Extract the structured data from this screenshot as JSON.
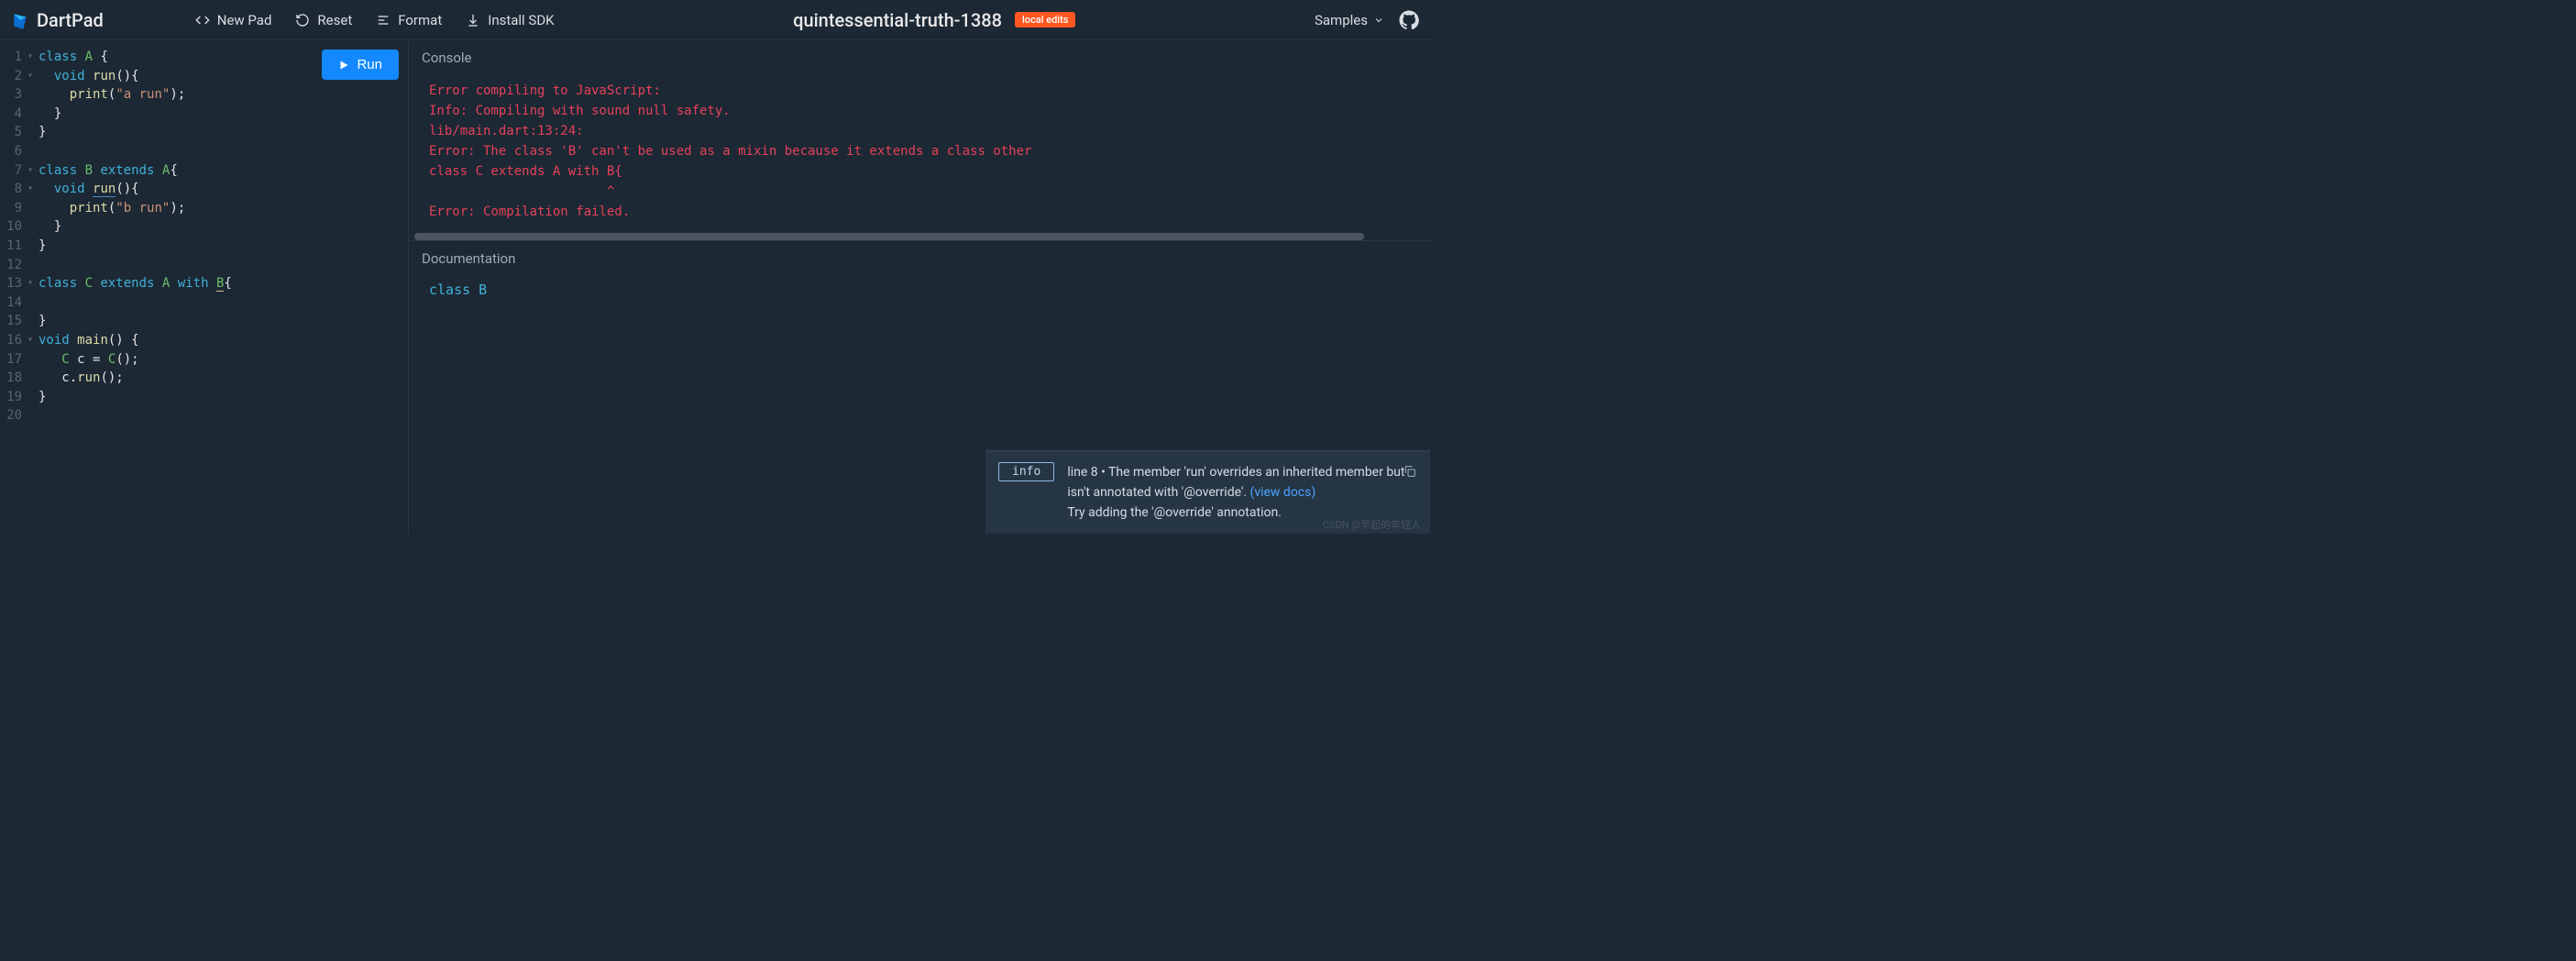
{
  "header": {
    "logo_text": "DartPad",
    "actions": {
      "new_pad": "New Pad",
      "reset": "Reset",
      "format": "Format",
      "install_sdk": "Install SDK"
    },
    "project_title": "quintessential-truth-1388",
    "local_badge": "local edits",
    "samples": "Samples"
  },
  "run_button": "Run",
  "editor": {
    "lines": [
      {
        "n": "1",
        "fold": true,
        "tokens": [
          [
            "kw",
            "class "
          ],
          [
            "typ",
            "A"
          ],
          [
            "wh",
            " {"
          ]
        ]
      },
      {
        "n": "2",
        "fold": true,
        "tokens": [
          [
            "wh",
            "  "
          ],
          [
            "kw",
            "void"
          ],
          [
            "wh",
            " "
          ],
          [
            "fn",
            "run"
          ],
          [
            "wh",
            "(){"
          ]
        ]
      },
      {
        "n": "3",
        "fold": false,
        "tokens": [
          [
            "wh",
            "    "
          ],
          [
            "fn",
            "print"
          ],
          [
            "wh",
            "("
          ],
          [
            "str",
            "\"a run\""
          ],
          [
            "wh",
            ");"
          ]
        ]
      },
      {
        "n": "4",
        "fold": false,
        "tokens": [
          [
            "wh",
            "  }"
          ]
        ]
      },
      {
        "n": "5",
        "fold": false,
        "tokens": [
          [
            "wh",
            "}"
          ]
        ]
      },
      {
        "n": "6",
        "fold": false,
        "tokens": []
      },
      {
        "n": "7",
        "fold": true,
        "tokens": [
          [
            "kw",
            "class "
          ],
          [
            "typ",
            "B"
          ],
          [
            "wh",
            " "
          ],
          [
            "kw",
            "extends"
          ],
          [
            "wh",
            " "
          ],
          [
            "typ",
            "A"
          ],
          [
            "wh",
            "{"
          ]
        ]
      },
      {
        "n": "8",
        "fold": true,
        "tokens": [
          [
            "wh",
            "  "
          ],
          [
            "kw",
            "void"
          ],
          [
            "wh",
            " "
          ],
          [
            "fn uline",
            "run"
          ],
          [
            "wh",
            "(){"
          ]
        ]
      },
      {
        "n": "9",
        "fold": false,
        "tokens": [
          [
            "wh",
            "    "
          ],
          [
            "fn",
            "print"
          ],
          [
            "wh",
            "("
          ],
          [
            "str",
            "\"b run\""
          ],
          [
            "wh",
            ");"
          ]
        ]
      },
      {
        "n": "10",
        "fold": false,
        "tokens": [
          [
            "wh",
            "  }"
          ]
        ]
      },
      {
        "n": "11",
        "fold": false,
        "tokens": [
          [
            "wh",
            "}"
          ]
        ]
      },
      {
        "n": "12",
        "fold": false,
        "tokens": []
      },
      {
        "n": "13",
        "fold": true,
        "tokens": [
          [
            "kw",
            "class "
          ],
          [
            "typ",
            "C"
          ],
          [
            "wh",
            " "
          ],
          [
            "kw",
            "extends"
          ],
          [
            "wh",
            " "
          ],
          [
            "typ",
            "A"
          ],
          [
            "wh",
            " "
          ],
          [
            "kw",
            "with"
          ],
          [
            "wh",
            " "
          ],
          [
            "typ warn",
            "B"
          ],
          [
            "wh",
            "{"
          ]
        ]
      },
      {
        "n": "14",
        "fold": false,
        "tokens": []
      },
      {
        "n": "15",
        "fold": false,
        "tokens": [
          [
            "wh",
            "}"
          ]
        ]
      },
      {
        "n": "16",
        "fold": true,
        "tokens": [
          [
            "kw",
            "void"
          ],
          [
            "wh",
            " "
          ],
          [
            "fn",
            "main"
          ],
          [
            "wh",
            "() {"
          ]
        ]
      },
      {
        "n": "17",
        "fold": false,
        "tokens": [
          [
            "wh",
            "   "
          ],
          [
            "typ",
            "C"
          ],
          [
            "wh",
            " c = "
          ],
          [
            "typ",
            "C"
          ],
          [
            "wh",
            "();"
          ]
        ]
      },
      {
        "n": "18",
        "fold": false,
        "tokens": [
          [
            "wh",
            "   c."
          ],
          [
            "fn",
            "run"
          ],
          [
            "wh",
            "();"
          ]
        ]
      },
      {
        "n": "19",
        "fold": false,
        "tokens": [
          [
            "wh",
            "}"
          ]
        ]
      },
      {
        "n": "20",
        "fold": false,
        "tokens": []
      }
    ]
  },
  "console": {
    "title": "Console",
    "output": "Error compiling to JavaScript:\nInfo: Compiling with sound null safety.\nlib/main.dart:13:24:\nError: The class 'B' can't be used as a mixin because it extends a class other\nclass C extends A with B{\n                       ^\nError: Compilation failed."
  },
  "docs": {
    "title": "Documentation",
    "body": "class B"
  },
  "issue": {
    "tag": "info",
    "line_ref": "line 8",
    "sep": " • ",
    "msg1": "The member 'run' overrides an inherited member but isn't annotated with '@override'.  ",
    "link": "(view docs)",
    "msg2": "Try adding the '@override' annotation."
  },
  "watermark": "CSDN @早起的年轻人"
}
